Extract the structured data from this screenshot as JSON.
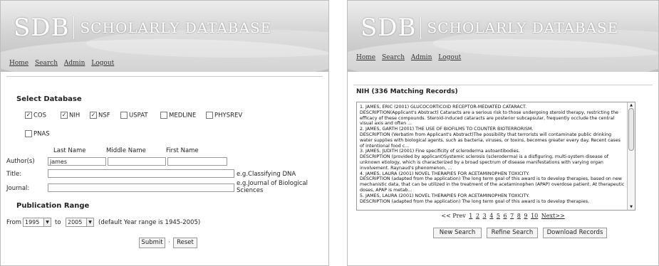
{
  "brand": {
    "mark": "SDB",
    "name": "SCHOLARLY DATABASE"
  },
  "nav": [
    "Home",
    "Search",
    "Admin",
    "Logout"
  ],
  "search_form": {
    "select_db_title": "Select Database",
    "databases": [
      {
        "label": "COS",
        "checked": true
      },
      {
        "label": "NIH",
        "checked": true
      },
      {
        "label": "NSF",
        "checked": true
      },
      {
        "label": "USPAT",
        "checked": false
      },
      {
        "label": "MEDLINE",
        "checked": false
      },
      {
        "label": "PHYSREV",
        "checked": false
      },
      {
        "label": "PNAS",
        "checked": false
      }
    ],
    "name_headers": [
      "Last Name",
      "Middle Name",
      "First Name"
    ],
    "author_label": "Author(s)",
    "author_last_value": "james",
    "title_label": "Title:",
    "title_hint": "e.g.Classifying DNA",
    "journal_label": "Journal:",
    "journal_hint": "e.g.Journal of Biological Sciences",
    "pub_range_title": "Publication Range",
    "from_label": "From",
    "from_value": "1995",
    "to_label": "to",
    "to_value": "2005",
    "range_note": "(default Year range is 1945-2005)",
    "submit_label": "Submit",
    "reset_label": "Reset"
  },
  "results": {
    "heading": "NIH (336 Matching Records)",
    "records": [
      "1. JAMES, ERIC (2001) GLUCOCORTICOID RECEPTOR-MEDIATED CATARACT.",
      "DESCRIPTION(Applicant's Abstract) Cataracts are a serious risk to those undergoing steroid therapy, restricting the efficacy of these compounds. Steroid-induced cataracts are posterior subcapsular, frequently occlude the central visual axis and often ...",
      "2. JAMES, GARTH (2001) THE USE OF BIOFILMS TO COUNTER BIOTERRORISM.",
      "DESCRIPTION (Verbatim from Applicant's Abstract)The possibility that terrorists will contaminate public drinking water supplies with biological agents, such as bacteria, viruses, or toxins, becomes greater every day. Recent cases of intentional food c...",
      "3. JAMES, JUDITH (2001) Fine specificity of scleroderma autoantibodies.",
      "DESCRIPTION (provided by applicant)Systemic sclerosis (scleroderma) is a disfiguring, multi-system disease of unknown etiology, which is characterized by a broad spectrum of disease manifestations with varying organ involvement. Raynaud's phenomenon, ...",
      "4. JAMES, LAURA (2001) NOVEL THERAPIES FOR ACETAMINOPHEN TOXICITY.",
      "DESCRIPTION (adapted from the application) The long term goal of this award is to develop therapies, based on new mechanistic data, that can be utilized in the treatment of the acetaminophen (APAP) overdose patient. At therapeutic doses, APAP is metab...",
      "5. JAMES, LAURA (2001) NOVEL THERAPIES FOR ACETAMINOPHEN TOXICITY.",
      "DESCRIPTION (adapted from the application) The long term goal of this award is to develop therapies,"
    ],
    "pager_prev": "<< Prev",
    "pages": [
      "1",
      "2",
      "3",
      "4",
      "5",
      "6",
      "7",
      "8",
      "9",
      "10"
    ],
    "pager_next": "Next>>",
    "buttons": [
      "New Search",
      "Refine Search",
      "Download Records"
    ]
  }
}
